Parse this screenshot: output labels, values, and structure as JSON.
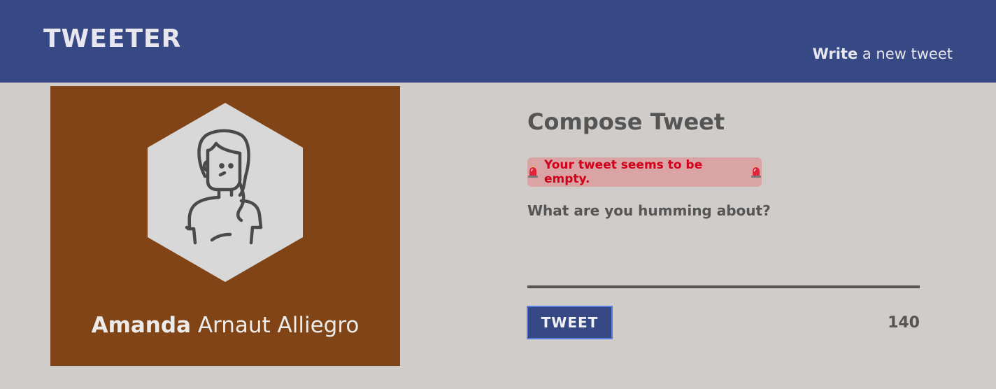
{
  "header": {
    "logo": "TWEETER",
    "compose_link_strong": "Write",
    "compose_link_rest": " a new tweet"
  },
  "profile": {
    "first_name": "Amanda",
    "last_name": " Arnaut Alliegro",
    "avatar_icon": "woman-avatar-icon",
    "background_color": "#804416"
  },
  "compose": {
    "title": "Compose Tweet",
    "error_message": "Your tweet seems to be empty.",
    "error_icon": "siren-icon",
    "prompt": "What are you humming about?",
    "textarea_value": "",
    "button_label": "TWEET",
    "char_counter": "140"
  },
  "colors": {
    "nav": "#374985",
    "page_bg": "#cfccc9",
    "error_bg": "#dba4a4",
    "error_text": "#d3001b",
    "text_dark": "#555555"
  }
}
